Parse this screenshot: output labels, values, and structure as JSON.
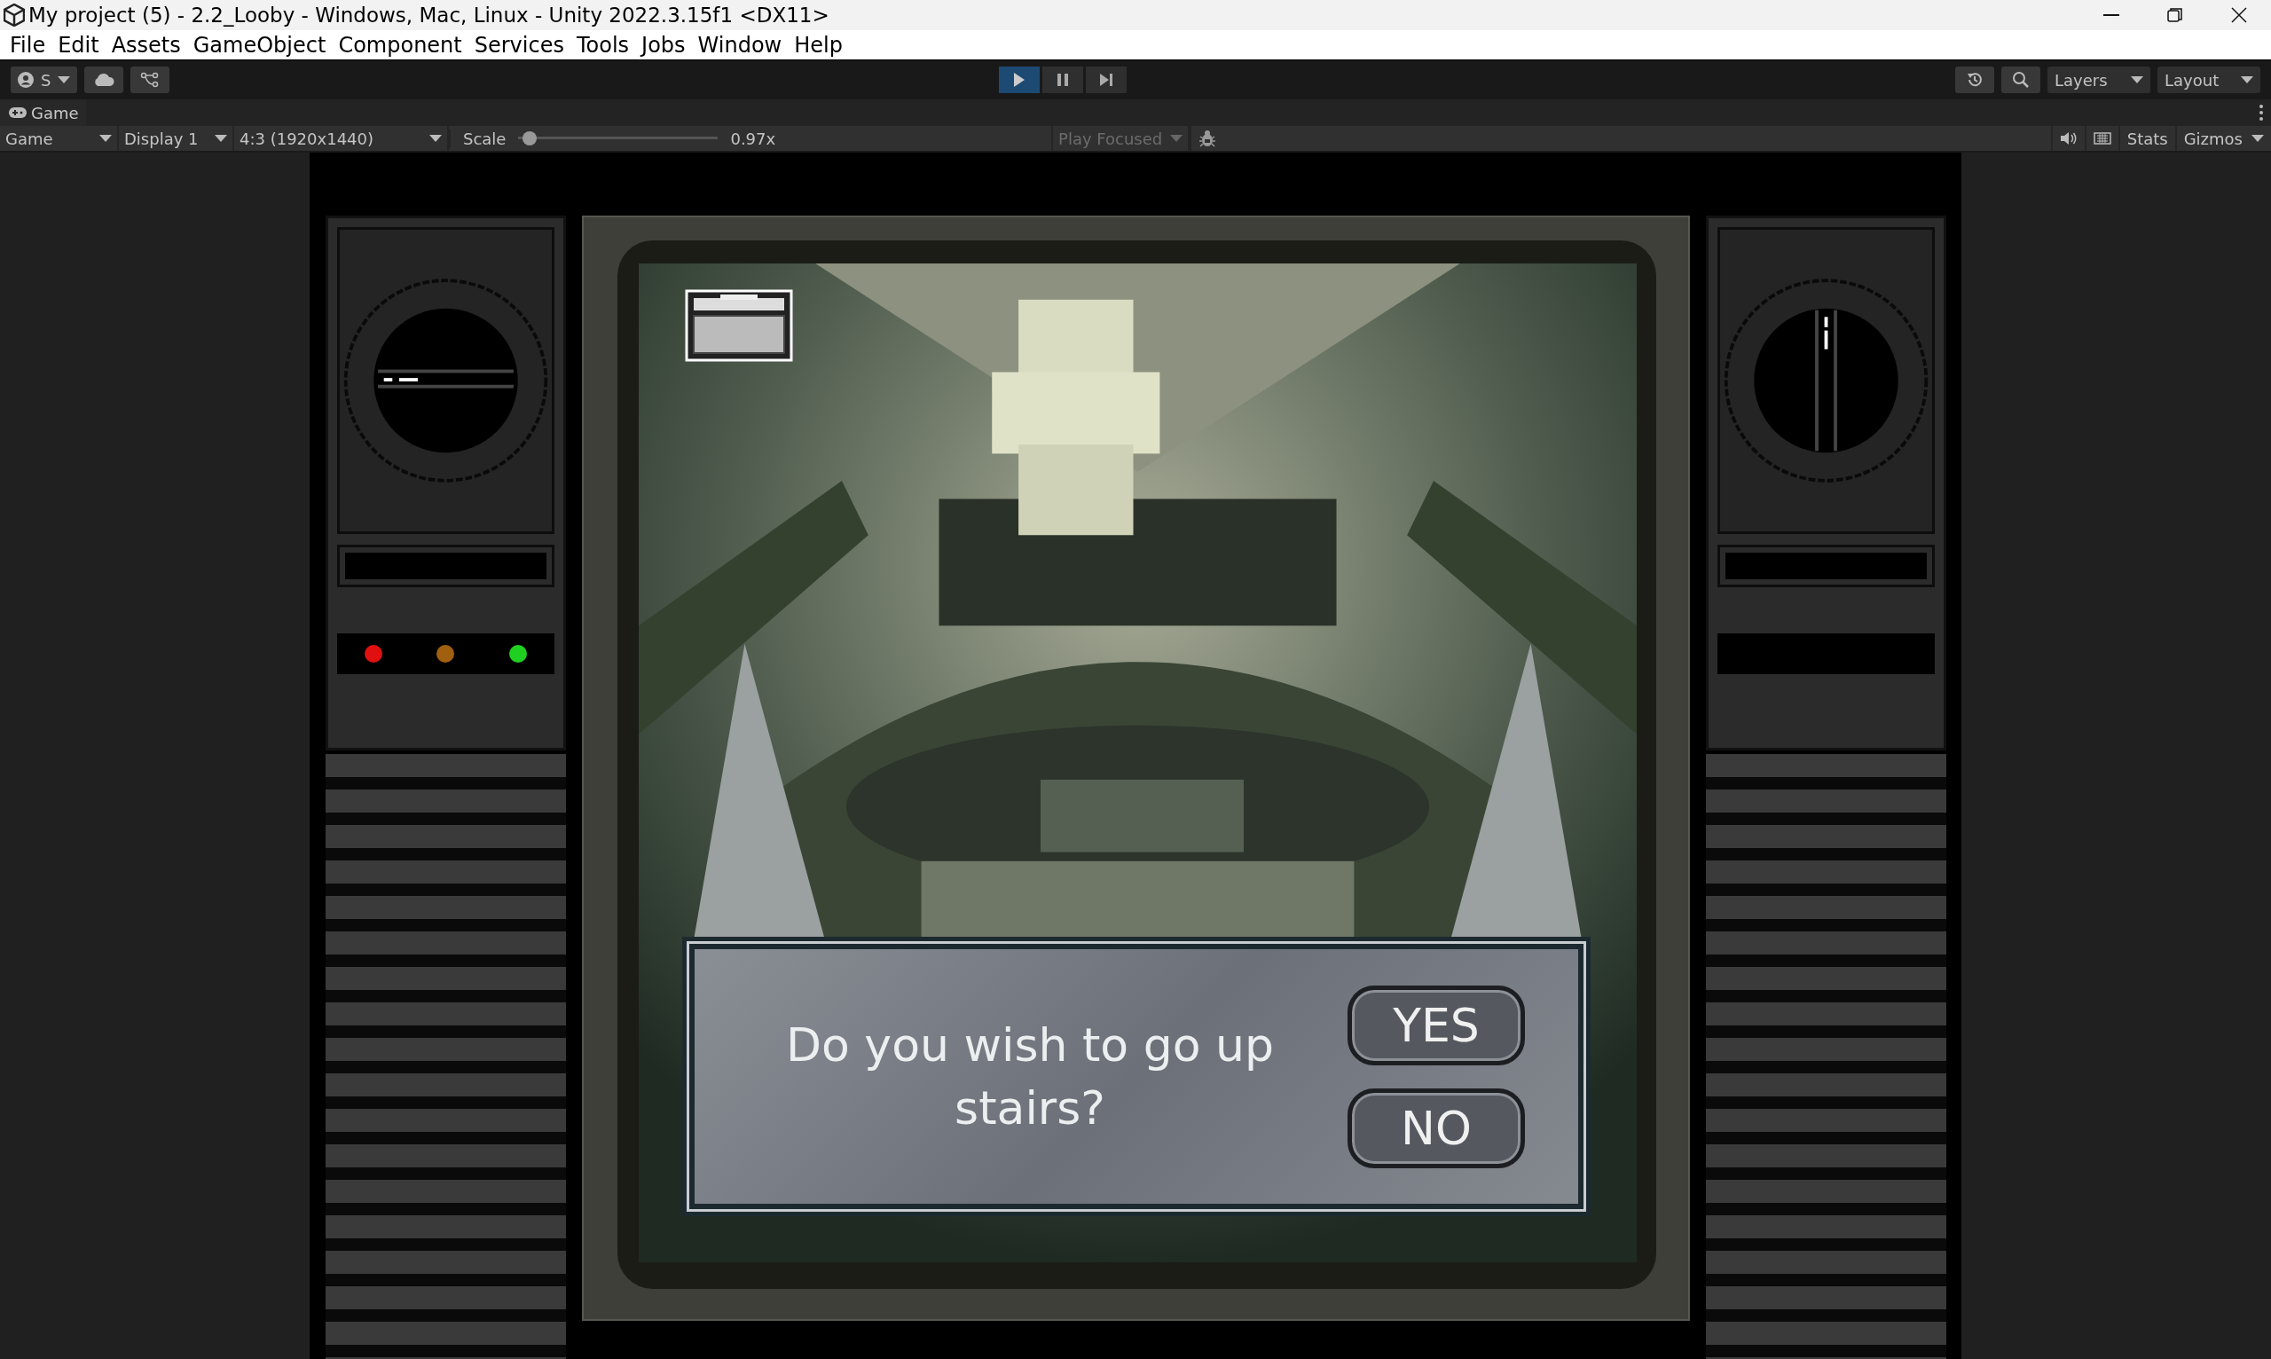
{
  "window": {
    "title": "My project (5) - 2.2_Looby - Windows, Mac, Linux - Unity 2022.3.15f1 <DX11>"
  },
  "menu": [
    "File",
    "Edit",
    "Assets",
    "GameObject",
    "Component",
    "Services",
    "Tools",
    "Jobs",
    "Window",
    "Help"
  ],
  "toolbar": {
    "account": "S",
    "play_controls": [
      {
        "kind": "play",
        "on": true
      },
      {
        "kind": "pause",
        "on": false
      },
      {
        "kind": "step",
        "on": false
      }
    ],
    "layers": "Layers",
    "layout": "Layout"
  },
  "game_tab": {
    "title": "Game"
  },
  "game_toolbar": {
    "view": "Game",
    "display": "Display 1",
    "aspect": "4:3 (1920x1440)",
    "scale_label": "Scale",
    "scale": {
      "level": 0.02
    },
    "scale_value": "0.97x",
    "play_mode": "Play Focused",
    "stats": "Stats",
    "gizmos": "Gizmos"
  },
  "game": {
    "left_panel": {
      "lights": [
        {
          "color": "#e01010"
        },
        {
          "color": "#a06010"
        },
        {
          "color": "#20d020"
        }
      ]
    },
    "dialog": {
      "question": "Do you wish to go up stairs?",
      "buttons": [
        "YES",
        "NO"
      ]
    }
  }
}
